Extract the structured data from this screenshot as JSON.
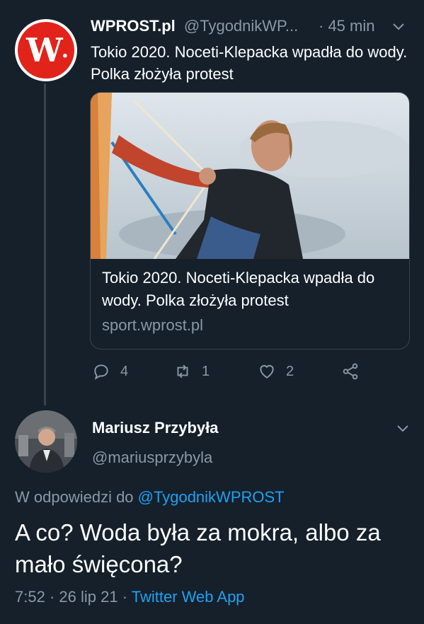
{
  "tweet1": {
    "name": "WPROST.pl",
    "handle": "@TygodnikWP...",
    "time": "· 45 min",
    "text": "Tokio 2020. Noceti-Klepacka wpadła do wody. Polka złożyła protest",
    "avatar_text": "W",
    "card": {
      "title": "Tokio 2020. Noceti-Klepacka wpadła do wody. Polka złożyła protest",
      "domain": "sport.wprost.pl"
    },
    "actions": {
      "replies": "4",
      "retweets": "1",
      "likes": "2"
    }
  },
  "tweet2": {
    "name": "Mariusz Przybyła",
    "handle": "@mariusprzybyla",
    "reply_prefix": "W odpowiedzi do",
    "reply_to": "@TygodnikWPROST",
    "text": "A co? Woda była za mokra, albo za mało święcona?",
    "time": "7:52",
    "sep1": "·",
    "date": "26 lip 21",
    "sep2": "·",
    "source": "Twitter Web App"
  },
  "colors": {
    "background": "#15202b",
    "muted": "#8899a6",
    "link": "#1da1f2",
    "brand_red": "#e2231a",
    "border": "#38444d"
  },
  "icons": [
    "reply-icon",
    "retweet-icon",
    "like-icon",
    "share-icon",
    "chevron-down-icon"
  ]
}
